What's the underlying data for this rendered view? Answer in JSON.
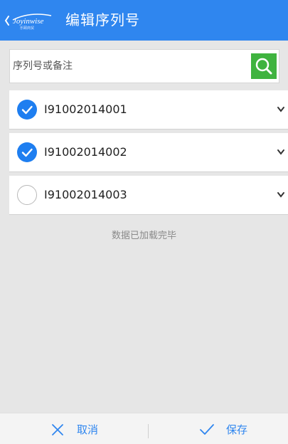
{
  "header": {
    "title": "编辑序列号",
    "logo_text": "Joyinwise",
    "logo_subtext": "乐颐商贸"
  },
  "search": {
    "placeholder": "序列号或备注",
    "value": ""
  },
  "serial_items": [
    {
      "serial": "I91002014001",
      "checked": true
    },
    {
      "serial": "I91002014002",
      "checked": true
    },
    {
      "serial": "I91002014003",
      "checked": false
    }
  ],
  "load_status": "数据已加载完毕",
  "footer": {
    "cancel_label": "取消",
    "save_label": "保存"
  },
  "colors": {
    "header_bg": "#2f86ef",
    "accent_blue": "#1e7ef0",
    "search_button": "#3fb33f",
    "page_bg": "#e6e6e6"
  }
}
